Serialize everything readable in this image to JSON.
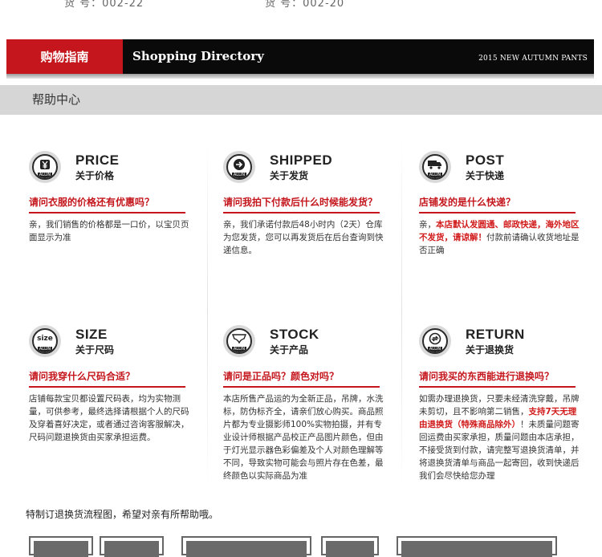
{
  "top_row": {
    "left_text": "货 号：002-22",
    "right_text": "货 号：002-20"
  },
  "header": {
    "section_label": "购物指南",
    "title": "Shopping Directory",
    "tagline": "2015 NEW AUTUMN PANTS",
    "accent_color": "#c4161c"
  },
  "help_center": {
    "label": "帮助中心"
  },
  "cards": [
    {
      "icon": "yen-icon",
      "title": "PRICE",
      "subtitle": "关于价格",
      "question": "请问衣服的价格还有优惠吗？",
      "answer": "亲，我们销售的价格都是一口价，以宝贝页面显示为准"
    },
    {
      "icon": "arrow-right-icon",
      "title": "SHIPPED",
      "subtitle": "关于发货",
      "question": "请问我拍下付款后什么时候能发货？",
      "answer": "亲，我们承诺付款后48小时内（2天）仓库为您发货，您可以再发货后在后台查询到快递信息。"
    },
    {
      "icon": "truck-icon",
      "title": "POST",
      "subtitle": "关于快递",
      "question": "店铺发的是什么快递？",
      "answer_pre": "亲，",
      "answer_red": "本店默认发圆通、邮政快递，海外地区不发货，请谅解！",
      "answer_post": "付款前请确认收货地址是否正确"
    },
    {
      "icon": "size-icon",
      "icon_text": "size",
      "title": "SIZE",
      "subtitle": "关于尺码",
      "question": "请问我穿什么尺码合适？",
      "answer": "店铺每款宝贝都设置尺码表，均为实物测量，可供参考，最终选择请根据个人的尺码及穿着喜好决定，或者通过咨询客服解决，尺码问题退换货由买家承担运费。"
    },
    {
      "icon": "underwear-icon",
      "title": "STOCK",
      "subtitle": "关于产品",
      "question": "请问是正品吗？颜色对吗？",
      "answer": "本店所售产品运的为全新正品，吊牌，水洗标，防伪标齐全，请亲们放心购买。商品照片都为专业摄影师100%实物拍摄，并有专业设计师根据产品校正产品图片颜色，但由于灯光显示器色彩偏差及个人对颜色理解等不同，导致实物可能会与照片存在色差，最终颜色以实际商品为准"
    },
    {
      "icon": "return-icon",
      "title": "RETURN",
      "subtitle": "关于退换货",
      "question": "请问我买的东西能进行退换吗？",
      "answer_pre": "如需办理退换货，只要未经清洗穿戴，吊牌未剪切，且不影响第二销售，",
      "answer_red": "支持7天无理由退换货（特殊商品除外）",
      "answer_post": "！未质量问题寄回运费由买家承担，质量问题由本店承担，不接受货到付款，请完整写退换货清单，并将退换货清单与商品一起寄回，收到快递后我们会尽快给您办理"
    }
  ],
  "badge_text": "ALLIN",
  "footer_note": "特制订退换货流程图，希望对亲有所帮助哦。"
}
